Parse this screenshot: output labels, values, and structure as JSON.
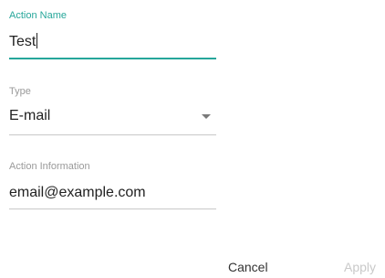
{
  "form": {
    "action_name": {
      "label": "Action Name",
      "value": "Test"
    },
    "type": {
      "label": "Type",
      "selected": "E-mail"
    },
    "action_information": {
      "label": "Action Information",
      "value": "email@example.com"
    }
  },
  "buttons": {
    "cancel_label": "Cancel",
    "apply_label": "Apply"
  },
  "colors": {
    "accent": "#26a69a",
    "label": "#9a9a9a",
    "text": "#222222",
    "disabled": "#c9c9c9"
  },
  "icons": {
    "type_dropdown": "chevron-down-icon"
  }
}
